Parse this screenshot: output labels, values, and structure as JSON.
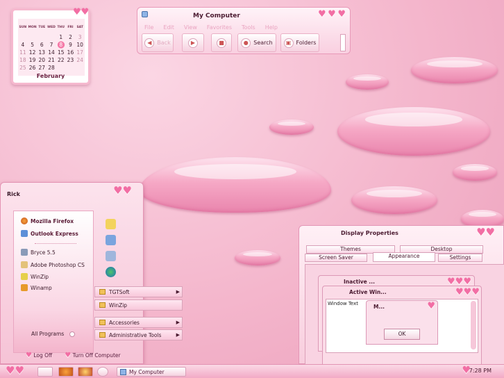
{
  "calendar": {
    "weekdays": [
      "SUN",
      "MON",
      "TUE",
      "WED",
      "THU",
      "FRI",
      "SAT"
    ],
    "rows": [
      [
        "",
        "",
        "",
        "",
        "1",
        "2",
        "3"
      ],
      [
        "4",
        "5",
        "6",
        "7",
        "8",
        "9",
        "10"
      ],
      [
        "11",
        "12",
        "13",
        "14",
        "15",
        "16",
        "17"
      ],
      [
        "18",
        "19",
        "20",
        "21",
        "22",
        "23",
        "24"
      ],
      [
        "25",
        "26",
        "27",
        "28",
        "",
        "",
        ""
      ]
    ],
    "month": "February"
  },
  "my_computer": {
    "title": "My Computer",
    "menu": [
      "File",
      "Edit",
      "View",
      "Favorites",
      "Tools",
      "Help"
    ],
    "back_label": "Back",
    "search_label": "Search",
    "folders_label": "Folders"
  },
  "start_menu": {
    "user": "Rick",
    "pinned": [
      "Mozilla Firefox",
      "Outlook Express"
    ],
    "recent": [
      "Bryce 5.5",
      "Adobe Photoshop CS",
      "WinZip",
      "Winamp"
    ],
    "all_programs": "All Programs",
    "log_off": "Log Off",
    "turn_off": "Turn Off Computer"
  },
  "submenu": {
    "items": [
      "TGTSoft",
      "WinZip",
      "Accessories",
      "Administrative Tools"
    ]
  },
  "display_properties": {
    "title": "Display Properties",
    "tabs_top": [
      "Themes",
      "Desktop"
    ],
    "tabs_bottom": [
      "Screen Saver",
      "Appearance",
      "Settings"
    ],
    "inactive_title": "Inactive ...",
    "active_title": "Active Win...",
    "window_text": "Window Text",
    "message_title": "M...",
    "ok_label": "OK"
  },
  "taskbar": {
    "task_label": "My Computer",
    "clock": "7:28 PM"
  },
  "colors": {
    "accent": "#f26ea4",
    "background": "#f4b6cc"
  }
}
